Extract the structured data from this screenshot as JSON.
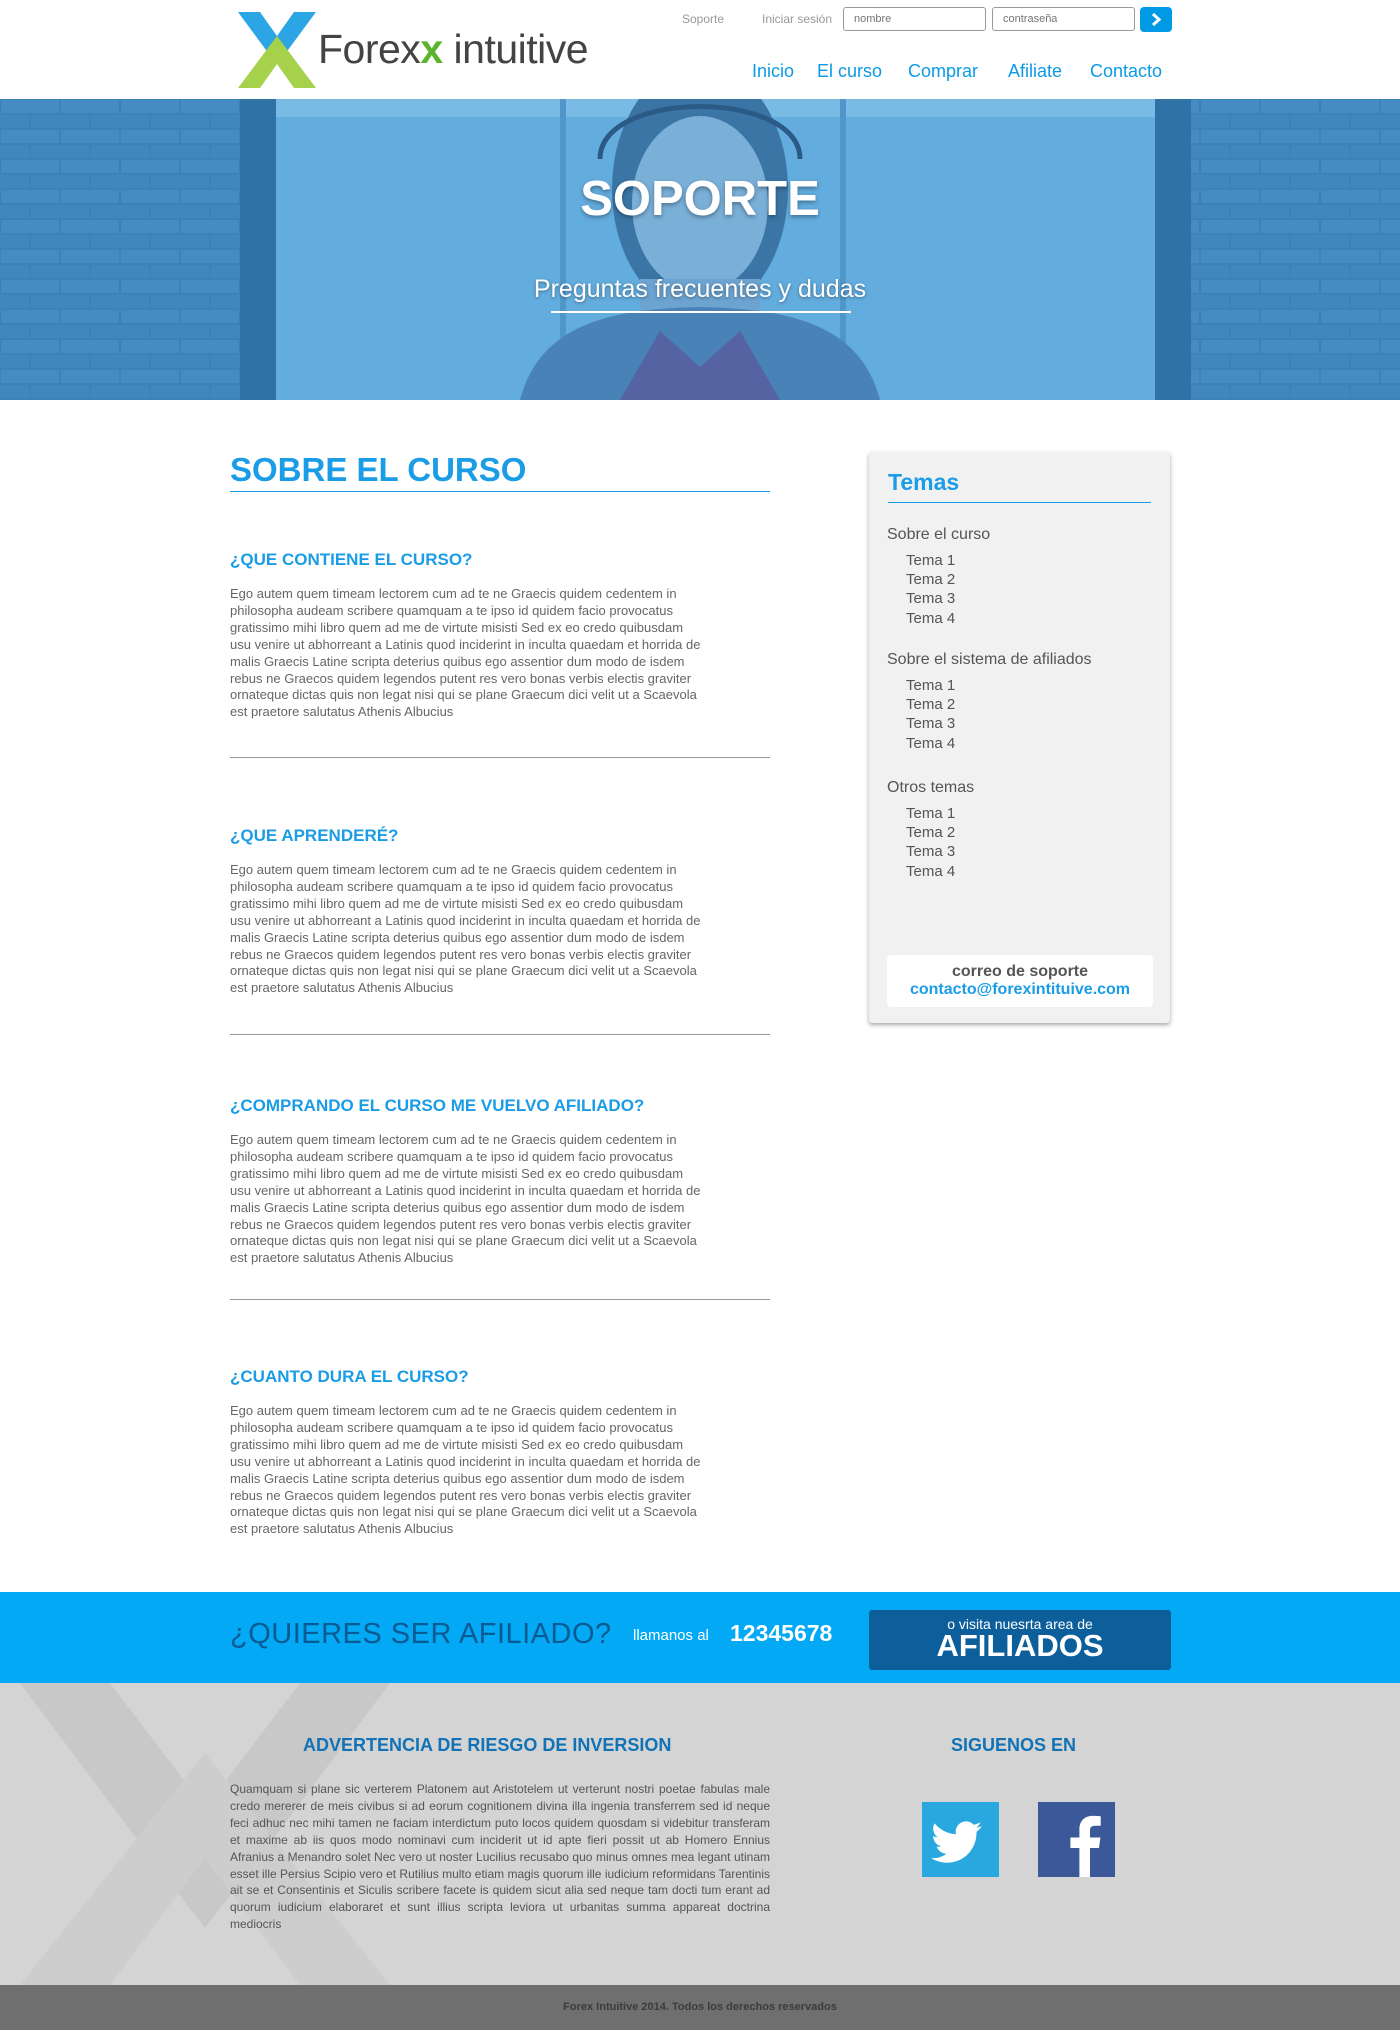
{
  "brand": {
    "name_part1": "Forex",
    "name_x": "x",
    "name_part2": "intuitive"
  },
  "header": {
    "support_link": "Soporte",
    "login_label": "Iniciar sesión",
    "username_placeholder": "nombre",
    "password_placeholder": "contraseña"
  },
  "nav": [
    "Inicio",
    "El curso",
    "Comprar",
    "Afiliate",
    "Contacto"
  ],
  "hero": {
    "title": "SOPORTE",
    "subtitle": "Preguntas frecuentes y dudas"
  },
  "main": {
    "title": "SOBRE EL CURSO",
    "faqs": [
      {
        "question": "¿QUE CONTIENE EL CURSO?",
        "lines": [
          "Ego autem quem timeam lectorem cum ad te ne Graecis quidem cedentem in",
          "philosopha audeam scribere quamquam a te ipso id quidem facio provocatus",
          "gratissimo mihi libro quem ad me de virtute misisti Sed ex eo credo quibusdam",
          "usu venire ut abhorreant a Latinis quod inciderint in inculta quaedam et horrida de",
          "malis Graecis Latine scripta deterius quibus ego assentior dum modo de isdem",
          "rebus ne Graecos quidem legendos putent res vero bonas verbis electis graviter",
          "ornateque dictas quis non legat nisi qui se plane Graecum dici velit ut a Scaevola",
          "est praetore salutatus Athenis Albucius"
        ]
      },
      {
        "question": "¿QUE APRENDERÉ?",
        "lines": [
          "Ego autem quem timeam lectorem cum ad te ne Graecis quidem cedentem in",
          "philosopha audeam scribere quamquam a te ipso id quidem facio provocatus",
          "gratissimo mihi libro quem ad me de virtute misisti Sed ex eo credo quibusdam",
          "usu venire ut abhorreant a Latinis quod inciderint in inculta quaedam et horrida de",
          "malis Graecis Latine scripta deterius quibus ego assentior dum modo de isdem",
          "rebus ne Graecos quidem legendos putent res vero bonas verbis electis graviter",
          "ornateque dictas quis non legat nisi qui se plane Graecum dici velit ut a Scaevola",
          "est praetore salutatus Athenis Albucius"
        ]
      },
      {
        "question": "¿COMPRANDO EL CURSO ME VUELVO AFILIADO?",
        "lines": [
          "Ego autem quem timeam lectorem cum ad te ne Graecis quidem cedentem in",
          "philosopha audeam scribere quamquam a te ipso id quidem facio provocatus",
          "gratissimo mihi libro quem ad me de virtute misisti Sed ex eo credo quibusdam",
          "usu venire ut abhorreant a Latinis quod inciderint in inculta quaedam et horrida de",
          "malis Graecis Latine scripta deterius quibus ego assentior dum modo de isdem",
          "rebus ne Graecos quidem legendos putent res vero bonas verbis electis graviter",
          "ornateque dictas quis non legat nisi qui se plane Graecum dici velit ut a Scaevola",
          "est praetore salutatus Athenis Albucius"
        ]
      },
      {
        "question": "¿CUANTO DURA EL CURSO?",
        "lines": [
          "Ego autem quem timeam lectorem cum ad te ne Graecis quidem cedentem in",
          "philosopha audeam scribere quamquam a te ipso id quidem facio provocatus",
          "gratissimo mihi libro quem ad me de virtute misisti Sed ex eo credo quibusdam",
          "usu venire ut abhorreant a Latinis quod inciderint in inculta quaedam et horrida de",
          "malis Graecis Latine scripta deterius quibus ego assentior dum modo de isdem",
          "rebus ne Graecos quidem legendos putent res vero bonas verbis electis graviter",
          "ornateque dictas quis non legat nisi qui se plane Graecum dici velit ut a Scaevola",
          "est praetore salutatus Athenis Albucius"
        ]
      }
    ]
  },
  "sidebar": {
    "title": "Temas",
    "groups": [
      {
        "label": "Sobre el curso",
        "items": [
          "Tema 1",
          "Tema 2",
          "Tema 3",
          "Tema 4"
        ]
      },
      {
        "label": "Sobre el sistema de afiliados",
        "items": [
          "Tema 1",
          "Tema 2",
          "Tema 3",
          "Tema 4"
        ]
      },
      {
        "label": "Otros temas",
        "items": [
          "Tema 1",
          "Tema 2",
          "Tema 3",
          "Tema 4"
        ]
      }
    ],
    "mail_label": "correo de soporte",
    "mail_address": "contacto@forexintituive.com"
  },
  "cta": {
    "question": "¿QUIERES SER AFILIADO?",
    "call_label": "llamanos al",
    "phone": "12345678",
    "button_small": "o visita nuesrta area de",
    "button_big": "AFILIADOS"
  },
  "footer": {
    "warning_title": "ADVERTENCIA DE RIESGO DE INVERSION",
    "warning_text": "Quamquam si plane sic verterem Platonem aut Aristotelem ut verterunt nostri poetae fabulas male credo mererer de meis civibus si ad eorum cognitionem divina illa ingenia transferrem sed id neque feci adhuc nec mihi tamen ne faciam interdictum puto locos quidem quosdam si videbitur transferam et maxime ab iis quos modo nominavi cum inciderit ut id apte fieri possit ut ab Homero Ennius Afranius a Menandro solet Nec vero ut noster Lucilius recusabo quo minus omnes mea legant utinam esset ille Persius Scipio vero et Rutilius multo etiam magis quorum ille iudicium reformidans Tarentinis ait se et Consentinis et Siculis scribere facete is quidem sicut alia sed neque tam docti tum erant ad quorum iudicium elaboraret et sunt illius scripta leviora ut urbanitas summa appareat doctrina mediocris",
    "social_title": "SIGUENOS EN",
    "copyright": "Forex Intuitive 2014.  Todos los derechos reservados"
  },
  "colors": {
    "accent": "#1a9ce6",
    "cta_band": "#03a9f4",
    "cta_button": "#0d5f9b",
    "footer_bg": "#d4d4d4",
    "bottom_bar": "#6f6f6f",
    "twitter": "#29a8e0",
    "facebook": "#3b5998",
    "logo_green": "#a5d14b",
    "logo_blue": "#2ba5e3"
  }
}
